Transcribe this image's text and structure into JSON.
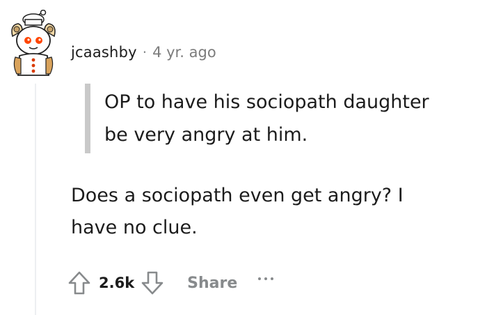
{
  "comment": {
    "username": "jcaashby",
    "separator": "·",
    "timestamp": "4 yr. ago",
    "quote": "OP to have his sociopath daughter\nbe very angry at him.",
    "body": "Does a sociopath even get angry? I\nhave no clue.",
    "score": "2.6k",
    "share_label": "Share"
  },
  "icons": {
    "upvote": "arrow-up-outline-icon",
    "downvote": "arrow-down-outline-icon",
    "more": "ellipsis-icon",
    "avatar": "snoo-avatar"
  },
  "colors": {
    "text": "#1c1c1c",
    "muted": "#878a8c",
    "quote_bar": "#c9c9c9",
    "thread_line": "#edeff1"
  }
}
